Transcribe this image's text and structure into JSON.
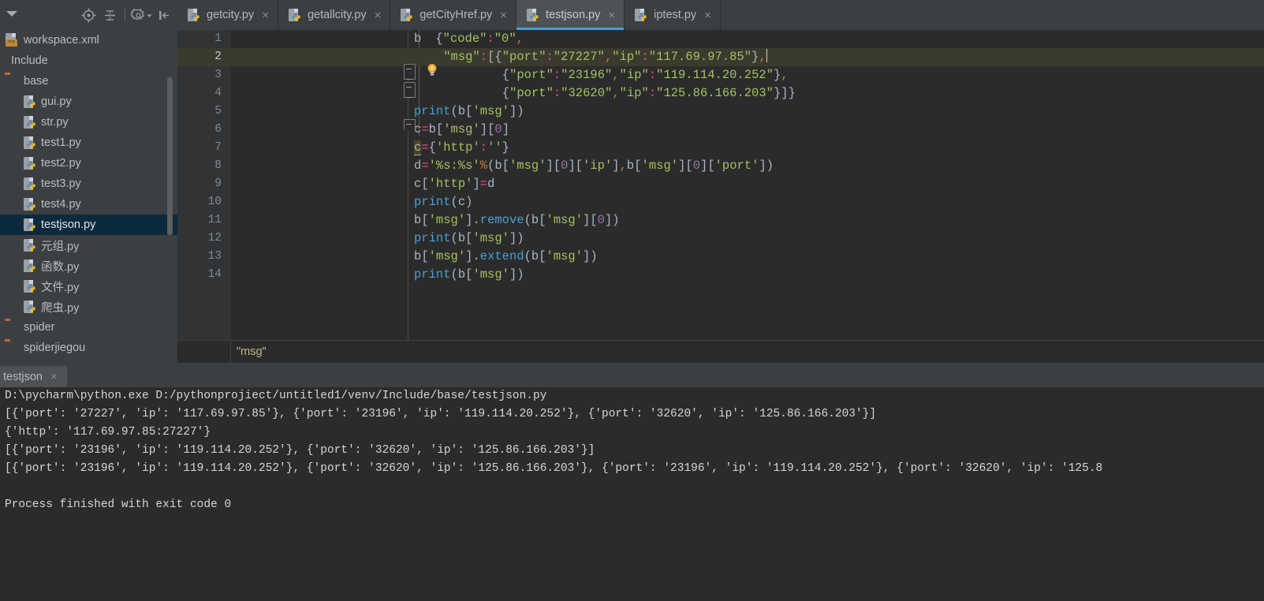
{
  "project_toolbar": {
    "caret_icon": "chevron-down-icon",
    "locate_icon": "target-locate-icon",
    "collapse_icon": "collapse-all-icon",
    "settings_icon": "gear-icon",
    "settings_caret_icon": "chevron-down-small-icon",
    "hide_icon": "hide-panel-icon"
  },
  "tabs": [
    {
      "label": "getcity.py",
      "icon": "python-file-icon",
      "close": "×",
      "active": false
    },
    {
      "label": "getallcity.py",
      "icon": "python-file-icon",
      "close": "×",
      "active": false
    },
    {
      "label": "getCityHref.py",
      "icon": "python-file-icon",
      "close": "×",
      "active": false
    },
    {
      "label": "testjson.py",
      "icon": "python-file-icon",
      "close": "×",
      "active": true
    },
    {
      "label": "iptest.py",
      "icon": "python-file-icon",
      "close": "×",
      "active": false
    }
  ],
  "tree": {
    "items": [
      {
        "label": "workspace.xml",
        "icon": "xml-file-icon",
        "indent": 0,
        "selected": false
      },
      {
        "label": "Include",
        "icon": "module-bar-icon",
        "indent": 0,
        "selected": false
      },
      {
        "label": "base",
        "icon": "folder-icon",
        "indent": 1,
        "selected": false
      },
      {
        "label": "gui.py",
        "icon": "python-file-icon",
        "indent": 2,
        "selected": false
      },
      {
        "label": "str.py",
        "icon": "python-file-icon",
        "indent": 2,
        "selected": false
      },
      {
        "label": "test1.py",
        "icon": "python-file-icon",
        "indent": 2,
        "selected": false
      },
      {
        "label": "test2.py",
        "icon": "python-file-icon",
        "indent": 2,
        "selected": false
      },
      {
        "label": "test3.py",
        "icon": "python-file-icon",
        "indent": 2,
        "selected": false
      },
      {
        "label": "test4.py",
        "icon": "python-file-icon",
        "indent": 2,
        "selected": false
      },
      {
        "label": "testjson.py",
        "icon": "python-file-icon",
        "indent": 2,
        "selected": true
      },
      {
        "label": "元组.py",
        "icon": "python-file-icon",
        "indent": 2,
        "selected": false
      },
      {
        "label": "函数.py",
        "icon": "python-file-icon",
        "indent": 2,
        "selected": false
      },
      {
        "label": "文件.py",
        "icon": "python-file-icon",
        "indent": 2,
        "selected": false
      },
      {
        "label": "爬虫.py",
        "icon": "python-file-icon",
        "indent": 2,
        "selected": false
      },
      {
        "label": "spider",
        "icon": "folder-icon",
        "indent": 1,
        "selected": false
      },
      {
        "label": "spiderjiegou",
        "icon": "folder-icon",
        "indent": 1,
        "selected": false
      }
    ]
  },
  "editor": {
    "line_numbers": [
      "1",
      "2",
      "3",
      "4",
      "5",
      "6",
      "7",
      "8",
      "9",
      "10",
      "11",
      "12",
      "13",
      "14"
    ],
    "current_line": 2,
    "bulb_icon": "intention-lightbulb-icon",
    "lines": [
      "b={\"code\":\"0\",",
      "    \"msg\":[{\"port\":\"27227\",\"ip\":\"117.69.97.85\"},",
      "            {\"port\":\"23196\",\"ip\":\"119.114.20.252\"},",
      "            {\"port\":\"32620\",\"ip\":\"125.86.166.203\"}]}",
      "print(b['msg'])",
      "c=b['msg'][0]",
      "c={'http':''}",
      "d='%s:%s'%(b['msg'][0]['ip'],b['msg'][0]['port'])",
      "c['http']=d",
      "print(c)",
      "b['msg'].remove(b['msg'][0])",
      "print(b['msg'])",
      "b['msg'].extend(b['msg'])",
      "print(b['msg'])"
    ]
  },
  "breadcrumb": {
    "text": "\"msg\""
  },
  "console": {
    "tab_label": "testjson",
    "tab_close": "×",
    "lines": [
      "D:\\pycharm\\python.exe D:/pythonprojiect/untitled1/venv/Include/base/testjson.py",
      "[{'port': '27227', 'ip': '117.69.97.85'}, {'port': '23196', 'ip': '119.114.20.252'}, {'port': '32620', 'ip': '125.86.166.203'}]",
      "{'http': '117.69.97.85:27227'}",
      "[{'port': '23196', 'ip': '119.114.20.252'}, {'port': '32620', 'ip': '125.86.166.203'}]",
      "[{'port': '23196', 'ip': '119.114.20.252'}, {'port': '32620', 'ip': '125.86.166.203'}, {'port': '23196', 'ip': '119.114.20.252'}, {'port': '32620', 'ip': '125.8",
      "",
      "Process finished with exit code 0"
    ]
  },
  "colors": {
    "accent": "#4a9fd4",
    "selection": "#0d293e",
    "editor_bg": "#2b2b2b",
    "panel_bg": "#3c3f41",
    "string": "#a5c261",
    "number": "#6897bb",
    "function": "#ffc66d",
    "folder": "#c0663a"
  }
}
